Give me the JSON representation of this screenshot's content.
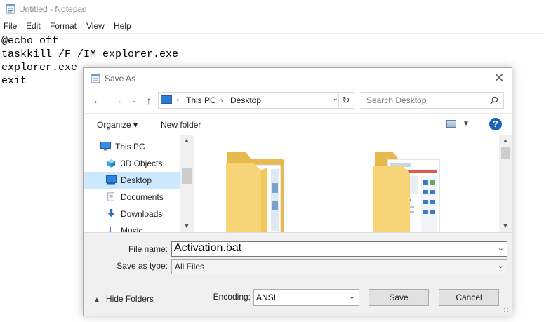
{
  "notepad": {
    "title": "Untitled - Notepad",
    "menu": [
      "File",
      "Edit",
      "Format",
      "View",
      "Help"
    ],
    "lines": [
      "@echo off",
      "taskkill /F /IM explorer.exe",
      "explorer.exe",
      "exit"
    ]
  },
  "dialog": {
    "title": "Save As",
    "close_glyph": "✕",
    "nav": {
      "back": "←",
      "forward": "→",
      "recent": "⌄",
      "up": "↑"
    },
    "address": {
      "segments": [
        "This PC",
        "Desktop"
      ],
      "separator": "›",
      "dropdown": "⌄",
      "refresh": "↻"
    },
    "search": {
      "placeholder": "Search Desktop",
      "icon": "search-icon"
    },
    "toolbar": {
      "organize": "Organize ▾",
      "new_folder": "New folder",
      "help": "?"
    },
    "tree": [
      {
        "label": "This PC",
        "icon": "computer-icon"
      },
      {
        "label": "3D Objects",
        "icon": "cube-icon"
      },
      {
        "label": "Desktop",
        "icon": "desktop-icon",
        "selected": true
      },
      {
        "label": "Documents",
        "icon": "documents-icon"
      },
      {
        "label": "Downloads",
        "icon": "download-icon"
      },
      {
        "label": "Music",
        "icon": "music-icon"
      }
    ],
    "file_name_label": "File name:",
    "file_name_value": "Activation.bat",
    "save_type_label": "Save as type:",
    "save_type_value": "All Files",
    "hide_folders": "Hide Folders",
    "encoding_label": "Encoding:",
    "encoding_value": "ANSI",
    "save_label": "Save",
    "cancel_label": "Cancel",
    "colors": {
      "selection": "#cce8ff",
      "folder": "#f7d477",
      "help": "#1a63b8"
    }
  }
}
